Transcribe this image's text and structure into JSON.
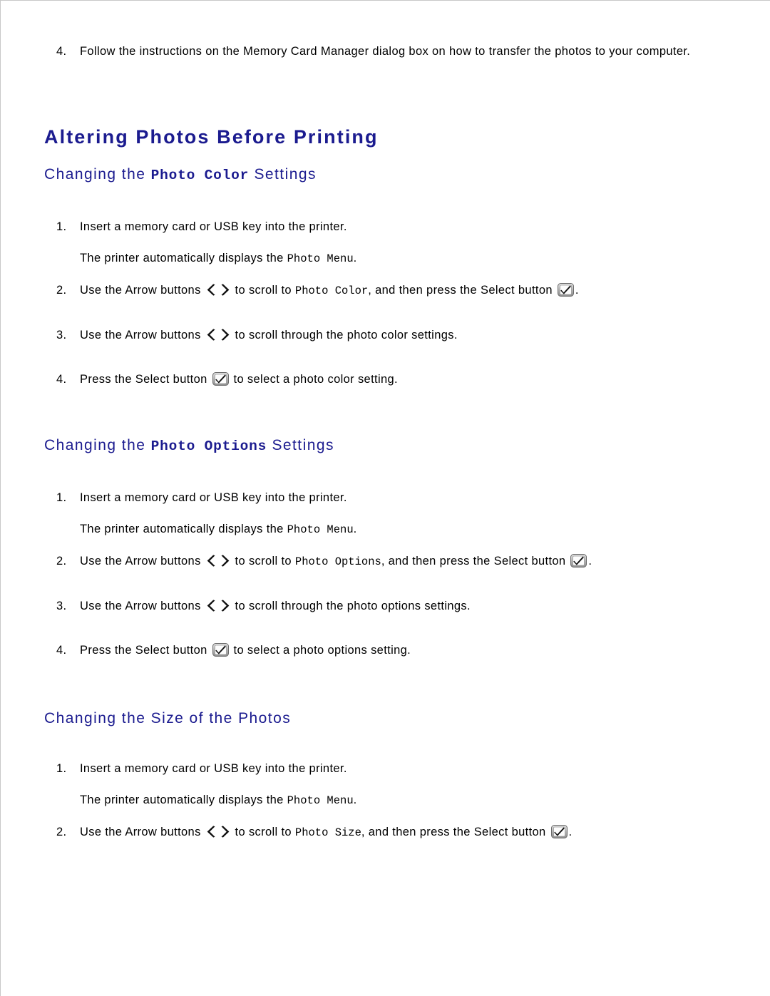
{
  "document": {
    "title": "Altering Photos Before Printing",
    "heading_color": "#1b1b8f",
    "text_color": "#000000",
    "background_color": "#ffffff"
  },
  "intro_step": {
    "number": "4.",
    "text": "Follow the instructions on the Memory Card Manager dialog box on how to transfer the photos to your computer."
  },
  "icons": {
    "arrow_buttons": "arrow-buttons-icon",
    "select_button": "select-button-icon"
  },
  "sections": [
    {
      "id": "photo-color",
      "heading_prefix": "Changing the ",
      "heading_mono": "Photo Color",
      "heading_suffix": " Settings",
      "steps": [
        {
          "number": "1.",
          "text": "Insert a memory card or USB key into the printer.",
          "substep_prefix": "The printer automatically displays the ",
          "substep_mono": "Photo Menu",
          "substep_suffix": "."
        },
        {
          "number": "2.",
          "text_before_arrows": "Use the Arrow buttons ",
          "text_after_arrows": " to scroll to ",
          "mono_term": "Photo Color",
          "text_after_term": ", and then press the Select button ",
          "text_after_select": "."
        },
        {
          "number": "3.",
          "text_before_arrows": "Use the Arrow buttons ",
          "text_after_arrows": " to scroll through the photo color settings."
        },
        {
          "number": "4.",
          "text_before_select": "Press the Select button ",
          "text_after_select": " to select a photo color setting."
        }
      ]
    },
    {
      "id": "photo-options",
      "heading_prefix": "Changing the ",
      "heading_mono": "Photo Options",
      "heading_suffix": " Settings",
      "steps": [
        {
          "number": "1.",
          "text": "Insert a memory card or USB key into the printer.",
          "substep_prefix": "The printer automatically displays the ",
          "substep_mono": "Photo Menu",
          "substep_suffix": "."
        },
        {
          "number": "2.",
          "text_before_arrows": "Use the Arrow buttons ",
          "text_after_arrows": " to scroll to ",
          "mono_term": "Photo Options",
          "text_after_term": ", and then press the Select button ",
          "text_after_select": "."
        },
        {
          "number": "3.",
          "text_before_arrows": "Use the Arrow buttons ",
          "text_after_arrows": " to scroll through the photo options settings."
        },
        {
          "number": "4.",
          "text_before_select": "Press the Select button ",
          "text_after_select": " to select a photo options setting."
        }
      ]
    },
    {
      "id": "photo-size",
      "heading_prefix": "Changing the Size of the Photos",
      "heading_mono": "",
      "heading_suffix": "",
      "steps": [
        {
          "number": "1.",
          "text": "Insert a memory card or USB key into the printer.",
          "substep_prefix": "The printer automatically displays the ",
          "substep_mono": "Photo Menu",
          "substep_suffix": "."
        },
        {
          "number": "2.",
          "text_before_arrows": "Use the Arrow buttons ",
          "text_after_arrows": " to scroll to ",
          "mono_term": "Photo Size",
          "text_after_term": ", and then press the Select button ",
          "text_after_select": "."
        }
      ]
    }
  ]
}
